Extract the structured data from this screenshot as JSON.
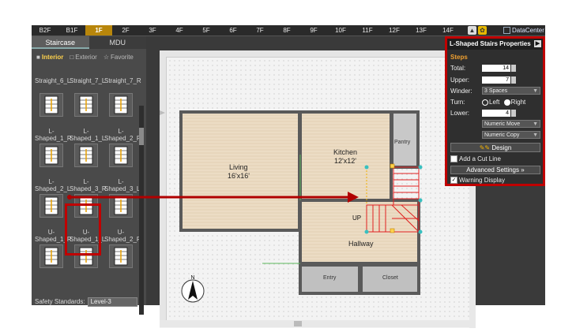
{
  "floors": [
    "B2F",
    "B1F",
    "1F",
    "2F",
    "3F",
    "4F",
    "5F",
    "6F",
    "7F",
    "8F",
    "9F",
    "10F",
    "11F",
    "12F",
    "13F",
    "14F"
  ],
  "active_floor": "1F",
  "datacenter_label": "DataCenter",
  "left_panel": {
    "tabs": [
      "Staircase",
      "MDU"
    ],
    "categories": [
      "Interior",
      "Exterior",
      "Favorite"
    ],
    "items": [
      {
        "label": "Straight_6_L"
      },
      {
        "label": "Straight_7_L"
      },
      {
        "label": "Straight_7_R"
      },
      {
        "label": "L-Shaped_1_R"
      },
      {
        "label": "L-Shaped_1_L"
      },
      {
        "label": "L-Shaped_2_R"
      },
      {
        "label": "L-Shaped_2_L"
      },
      {
        "label": "L-Shaped_3_R"
      },
      {
        "label": "L-Shaped_3_L"
      },
      {
        "label": "U-Shaped_1_R"
      },
      {
        "label": "U-Shaped_1_L"
      },
      {
        "label": "U-Shaped_2_R"
      }
    ],
    "safety_label": "Safety Standards:",
    "safety_value": "Level-3"
  },
  "plan": {
    "rooms": [
      {
        "name": "Living",
        "size": "16'x16'"
      },
      {
        "name": "Kitchen",
        "size": "12'x12'"
      },
      {
        "name": "Pantry",
        "size": ""
      },
      {
        "name": "Hallway",
        "size": ""
      },
      {
        "name": "Entry",
        "size": ""
      },
      {
        "name": "Closet",
        "size": ""
      }
    ],
    "stair_label": "UP"
  },
  "properties": {
    "title": "L-Shaped Stairs Properties",
    "steps_header": "Steps",
    "total_label": "Total:",
    "total_value": "14",
    "upper_label": "Upper:",
    "upper_value": "7",
    "winder_label": "Winder:",
    "winder_value": "3 Spaces",
    "turn_label": "Turn:",
    "turn_left": "Left",
    "turn_right": "Right",
    "lower_label": "Lower:",
    "lower_value": "4",
    "numeric_move": "Numeric Move",
    "numeric_copy": "Numeric Copy",
    "design_label": "Design",
    "cut_line_label": "Add a Cut Line",
    "advanced_label": "Advanced Settings",
    "warning_label": "Warning Display"
  }
}
